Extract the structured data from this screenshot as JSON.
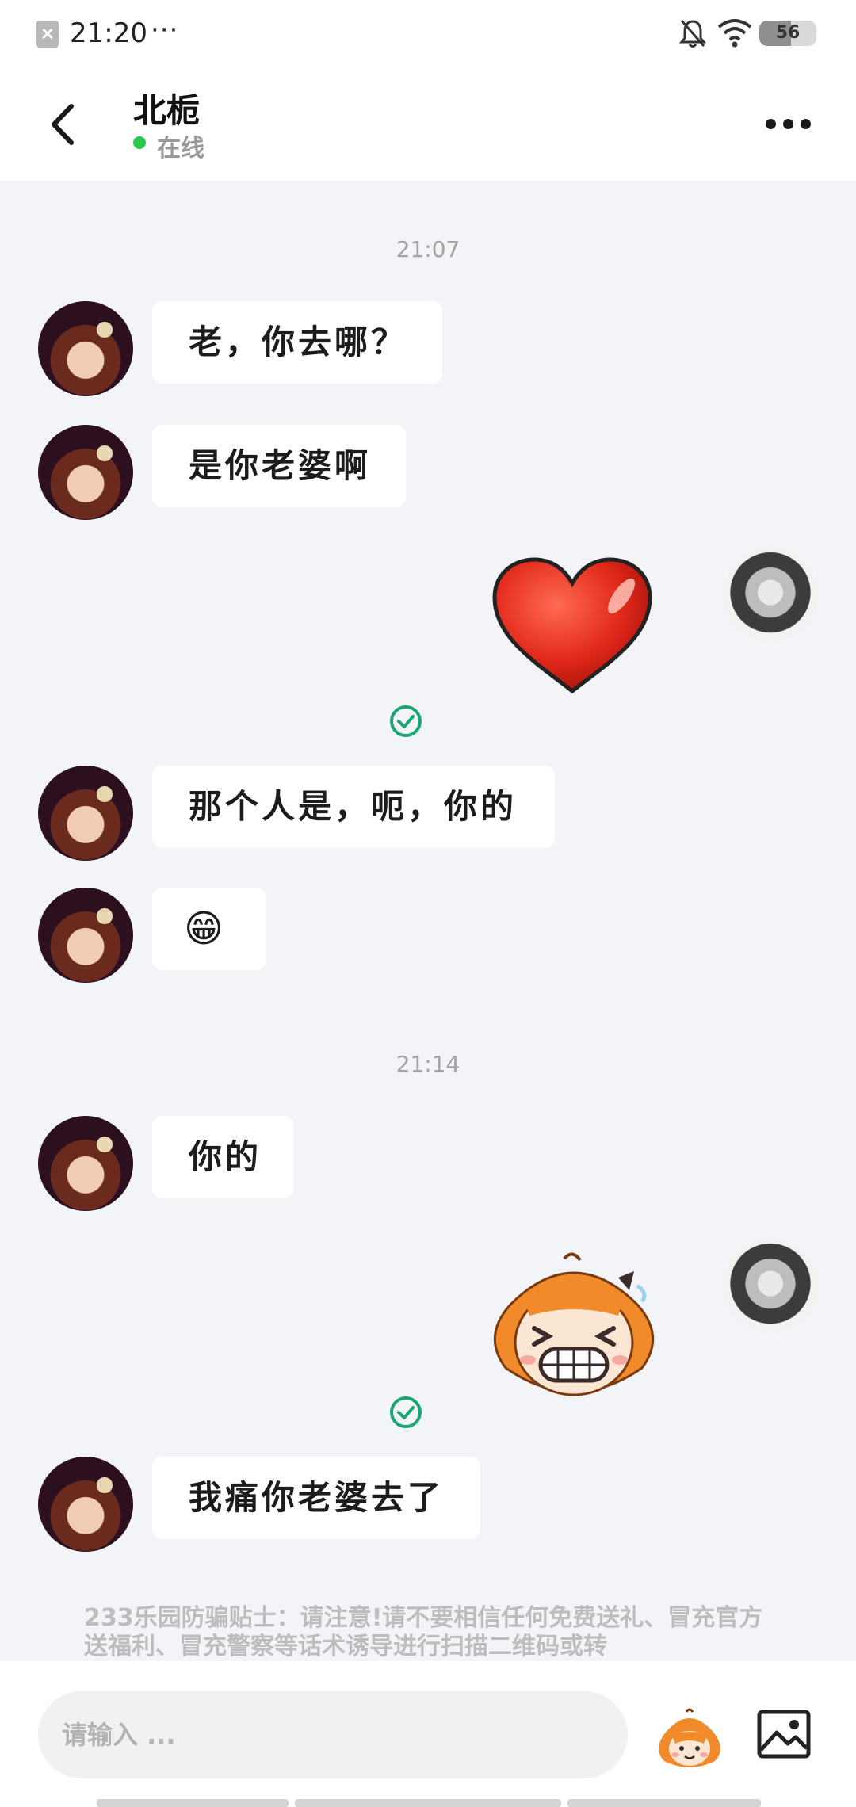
{
  "status_bar": {
    "time": "21:20",
    "more": "···",
    "battery": "56",
    "battery_level": 0.56
  },
  "header": {
    "title": "北栀",
    "status": "在线"
  },
  "messages": {
    "timestamp_1": "21:07",
    "m1": "老，你去哪？",
    "m2": "是你老婆啊",
    "m4": "那个人是，呃，你的",
    "m5": "😁",
    "timestamp_2": "21:14",
    "m6": "你的",
    "m8": "我痛你老婆去了"
  },
  "notice": {
    "text": "233乐园防骗贴士：请注意!请不要相信任何免费送礼、冒充官方送福利、冒充警察等话术诱导进行扫描二维码或转"
  },
  "input": {
    "placeholder": "请输入 ..."
  },
  "colors": {
    "accent_green": "#1aa671",
    "online_green": "#2bc84e",
    "heart_red": "#e0281c",
    "sticker_orange": "#f08a2a"
  }
}
